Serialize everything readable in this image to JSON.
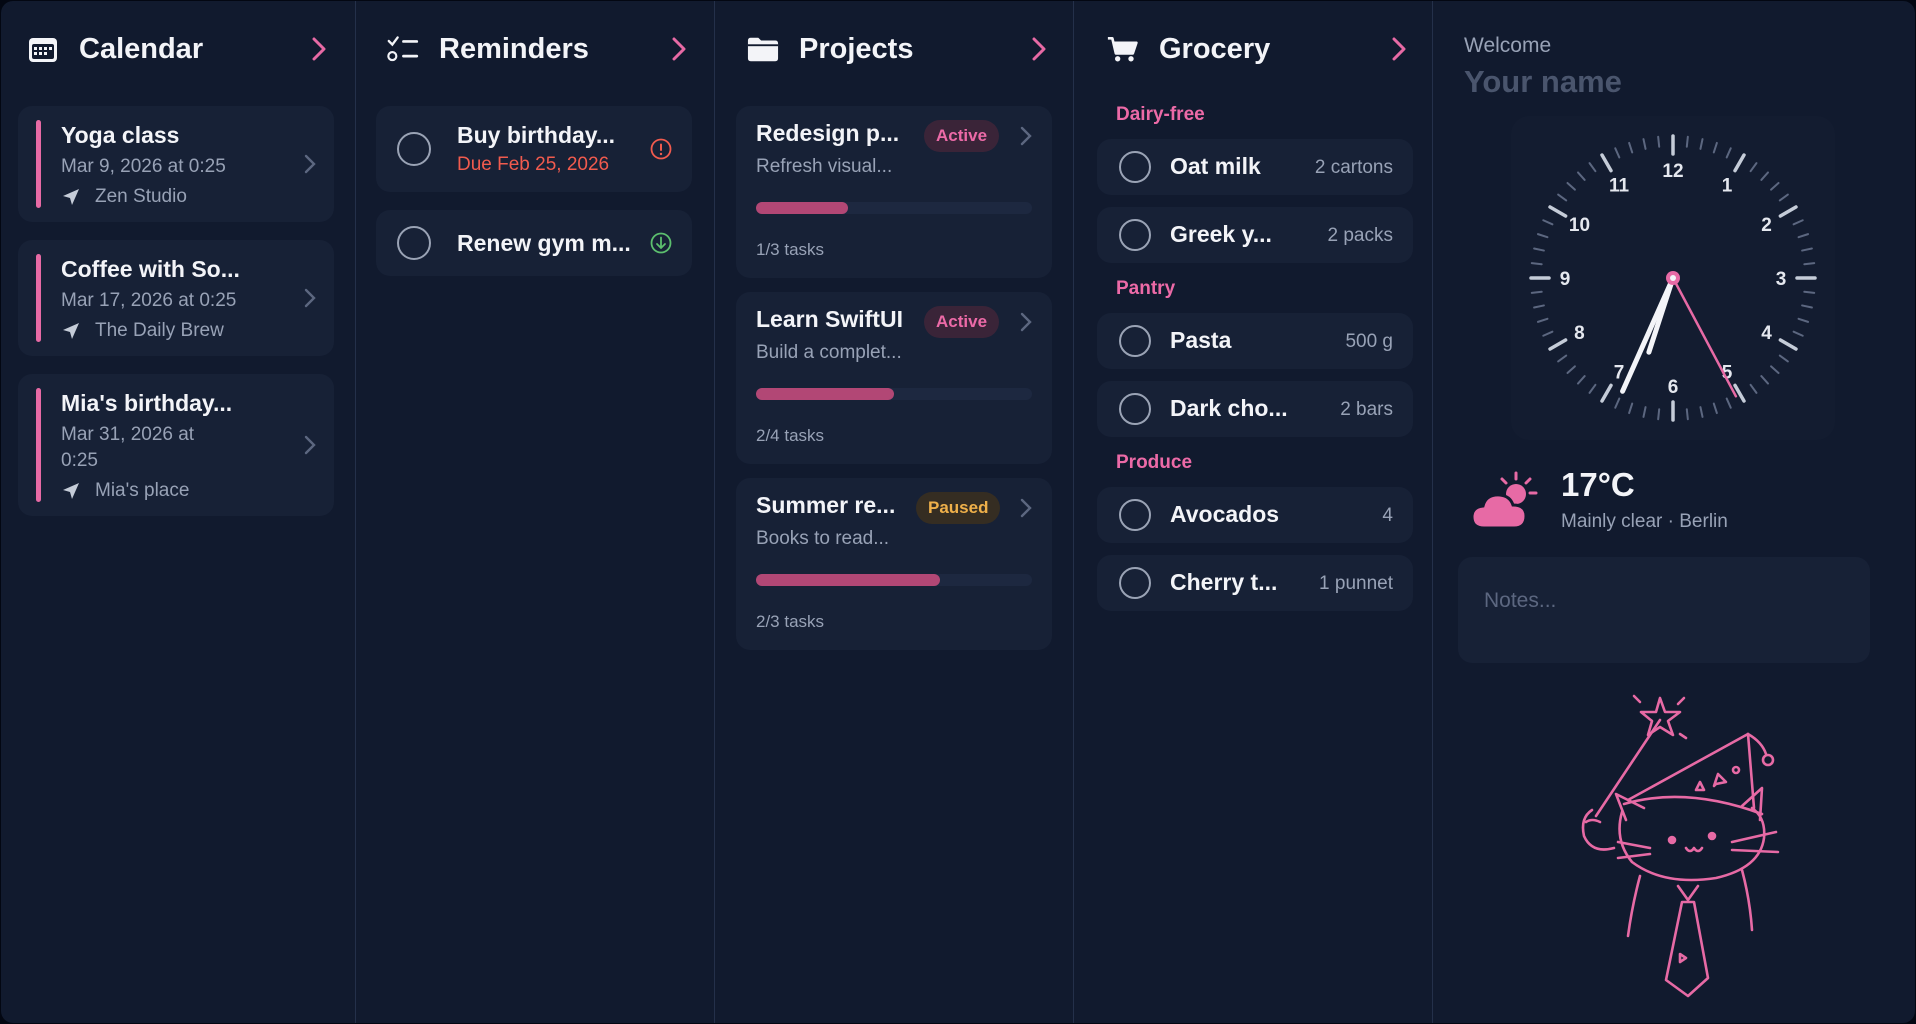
{
  "calendar": {
    "title": "Calendar",
    "events": [
      {
        "title": "Yoga class",
        "date": "Mar 9, 2026 at 0:25",
        "location": "Zen Studio"
      },
      {
        "title": "Coffee with So...",
        "date": "Mar 17, 2026 at 0:25",
        "location": "The Daily Brew"
      },
      {
        "title": "Mia's birthday...",
        "date_line1": "Mar 31, 2026 at",
        "date_line2": "0:25",
        "location": "Mia's place"
      }
    ]
  },
  "reminders": {
    "title": "Reminders",
    "items": [
      {
        "title": "Buy birthday...",
        "due": "Due Feb 25, 2026",
        "status": "overdue"
      },
      {
        "title": "Renew gym m...",
        "status": "low-priority"
      }
    ]
  },
  "projects": {
    "title": "Projects",
    "items": [
      {
        "title": "Redesign p...",
        "subtitle": "Refresh visual...",
        "status": "Active",
        "progress": 0.333,
        "count": "1/3 tasks"
      },
      {
        "title": "Learn SwiftUI",
        "subtitle": "Build a complet...",
        "status": "Active",
        "progress": 0.5,
        "count": "2/4 tasks"
      },
      {
        "title": "Summer re...",
        "subtitle": "Books to read...",
        "status": "Paused",
        "progress": 0.667,
        "count": "2/3 tasks"
      }
    ]
  },
  "grocery": {
    "title": "Grocery",
    "categories": [
      {
        "name": "Dairy-free",
        "items": [
          {
            "name": "Oat milk",
            "qty": "2 cartons"
          },
          {
            "name": "Greek y...",
            "qty": "2 packs"
          }
        ]
      },
      {
        "name": "Pantry",
        "items": [
          {
            "name": "Pasta",
            "qty": "500 g"
          },
          {
            "name": "Dark cho...",
            "qty": "2 bars"
          }
        ]
      },
      {
        "name": "Produce",
        "items": [
          {
            "name": "Avocados",
            "qty": "4"
          },
          {
            "name": "Cherry t...",
            "qty": "1 punnet"
          }
        ]
      }
    ]
  },
  "profile": {
    "welcome": "Welcome",
    "name_placeholder": "Your name"
  },
  "clock": {
    "numbers": [
      "12",
      "1",
      "2",
      "3",
      "4",
      "5",
      "6",
      "7",
      "8",
      "9",
      "10",
      "11"
    ],
    "hour": 6.6,
    "minute": 34,
    "second": 27
  },
  "weather": {
    "temperature": "17°C",
    "condition": "Mainly clear · Berlin",
    "icon": "partly-cloudy-icon"
  },
  "notes": {
    "placeholder": "Notes..."
  },
  "colors": {
    "accent": "#e76aa5",
    "background": "#111a2e",
    "card": "#172136",
    "overdue": "#f15b4e",
    "ok": "#5cbf6e",
    "paused": "#efb04a"
  }
}
